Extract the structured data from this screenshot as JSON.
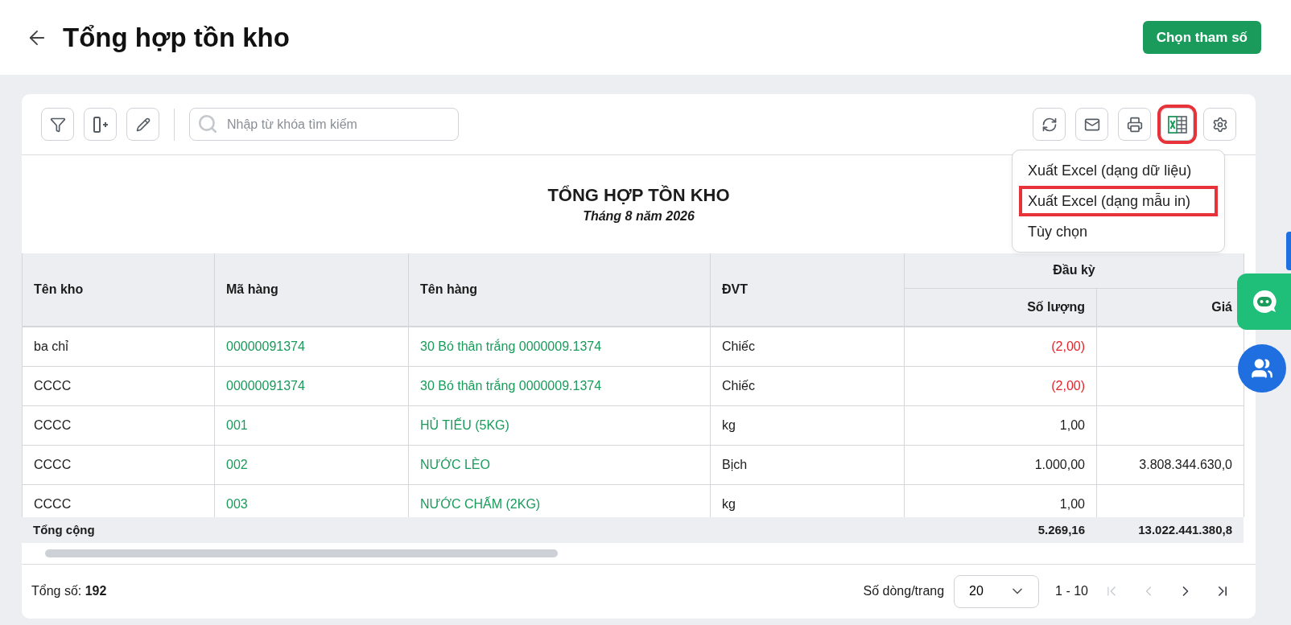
{
  "header": {
    "title": "Tổng hợp tồn kho",
    "action": "Chọn tham số"
  },
  "toolbar": {
    "left_buttons": [
      {
        "kind": "filter",
        "highlighted": false
      },
      {
        "kind": "add-column",
        "highlighted": false
      },
      {
        "kind": "edit",
        "highlighted": false
      }
    ],
    "search": {
      "placeholder": "Nhập từ khóa tìm kiếm"
    },
    "right_buttons": [
      {
        "kind": "refresh",
        "highlighted": false
      },
      {
        "kind": "email",
        "highlighted": false
      },
      {
        "kind": "print",
        "highlighted": false
      },
      {
        "kind": "excel",
        "highlighted": true
      },
      {
        "kind": "settings",
        "highlighted": false
      }
    ]
  },
  "export_menu": {
    "items": [
      {
        "label": "Xuất Excel (dạng dữ liệu)",
        "highlighted": false
      },
      {
        "label": "Xuất Excel (dạng mẫu in)",
        "highlighted": true
      },
      {
        "label": "Tùy chọn",
        "highlighted": false
      }
    ]
  },
  "report": {
    "title": "TỔNG HỢP TỒN KHO",
    "subtitle": "Tháng 8 năm 2026"
  },
  "table": {
    "columns": [
      {
        "kind": "text",
        "label": "Tên kho"
      },
      {
        "kind": "link",
        "label": "Mã hàng"
      },
      {
        "kind": "link",
        "label": "Tên hàng"
      },
      {
        "kind": "text",
        "label": "ĐVT"
      },
      {
        "kind": "group",
        "label": "Đầu kỳ",
        "columns": [
          {
            "kind": "number",
            "label": "Số lượng"
          },
          {
            "kind": "number",
            "label": "Giá"
          }
        ]
      }
    ],
    "rows": [
      {
        "values": [
          "ba chỉ",
          "00000091374",
          "30 Bó thân trắng 0000009.1374",
          "Chiếc",
          "(2,00)"
        ],
        "negative": true
      },
      {
        "values": [
          "CCCC",
          "00000091374",
          "30 Bó thân trắng 0000009.1374",
          "Chiếc",
          "(2,00)"
        ],
        "negative": true
      },
      {
        "values": [
          "CCCC",
          "001",
          "HỦ TIẾU (5KG)",
          "kg",
          "1,00"
        ],
        "negative": false
      },
      {
        "values": [
          "CCCC",
          "002",
          "NƯỚC LÈO",
          "Bịch",
          "1.000,00",
          "3.808.344.630,0"
        ],
        "negative": false
      },
      {
        "values": [
          "CCCC",
          "003",
          "NƯỚC CHẤM (2KG)",
          "kg",
          "1,00"
        ],
        "negative": false
      }
    ],
    "total": {
      "label": "Tổng cộng",
      "values": [
        "5.269,16",
        "13.022.441.380,8"
      ]
    }
  },
  "footer": {
    "count": "Tổng số: **192**",
    "page_size_label": "Số dòng/trang",
    "page_size": "20",
    "range": "1 - 10",
    "nav": [
      {
        "kind": "first",
        "disabled": true
      },
      {
        "kind": "prev",
        "disabled": true
      },
      {
        "kind": "next",
        "disabled": false
      },
      {
        "kind": "last",
        "disabled": false
      }
    ]
  }
}
